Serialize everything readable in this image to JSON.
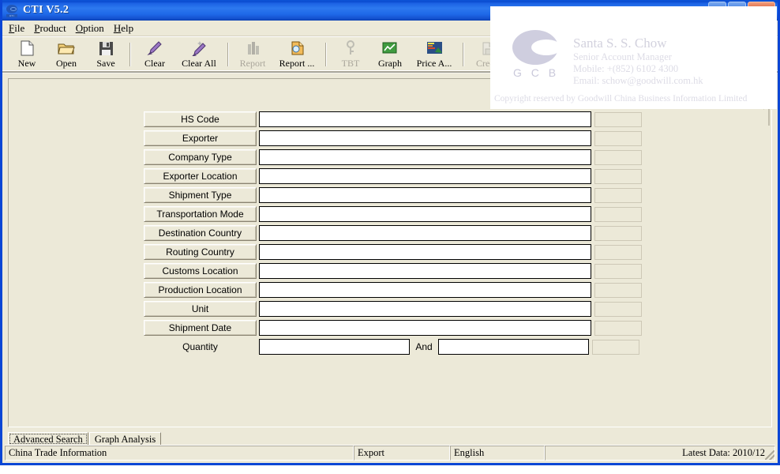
{
  "window": {
    "title": "CTI V5.2",
    "icon": "gcb-logo-icon",
    "buttons": {
      "minimize": "_",
      "maximize": "□",
      "close": "✕"
    }
  },
  "menu": [
    {
      "name": "file",
      "accel": "F",
      "rest": "ile"
    },
    {
      "name": "product",
      "accel": "P",
      "rest": "roduct"
    },
    {
      "name": "option",
      "accel": "O",
      "rest": "ption"
    },
    {
      "name": "help",
      "accel": "H",
      "rest": "elp"
    }
  ],
  "toolbar": [
    {
      "name": "new",
      "label": "New",
      "icon": "new-page-icon",
      "disabled": false
    },
    {
      "name": "open",
      "label": "Open",
      "icon": "open-folder-icon",
      "disabled": false
    },
    {
      "name": "save",
      "label": "Save",
      "icon": "floppy-disk-icon",
      "disabled": false
    },
    {
      "name": "clear",
      "label": "Clear",
      "icon": "pencil-icon",
      "disabled": false
    },
    {
      "name": "clear-all",
      "label": "Clear All",
      "icon": "pencil-sparkle-icon",
      "disabled": false
    },
    {
      "name": "report",
      "label": "Report",
      "icon": "report-icon",
      "disabled": true
    },
    {
      "name": "report-dots",
      "label": "Report ...",
      "icon": "report-page-icon",
      "disabled": false
    },
    {
      "name": "tbt",
      "label": "TBT",
      "icon": "key-icon",
      "disabled": true
    },
    {
      "name": "graph",
      "label": "Graph",
      "icon": "graph-icon",
      "disabled": false
    },
    {
      "name": "price-analysis",
      "label": "Price A...",
      "icon": "price-chart-icon",
      "disabled": false
    },
    {
      "name": "credit",
      "label": "Credit",
      "icon": "credit-icon",
      "disabled": true
    }
  ],
  "form": {
    "rows": [
      {
        "name": "hs-code",
        "label": "HS Code",
        "value": "",
        "button_label": true
      },
      {
        "name": "exporter",
        "label": "Exporter",
        "value": "",
        "button_label": true
      },
      {
        "name": "company-type",
        "label": "Company Type",
        "value": "",
        "button_label": true
      },
      {
        "name": "exporter-location",
        "label": "Exporter Location",
        "value": "",
        "button_label": true
      },
      {
        "name": "shipment-type",
        "label": "Shipment Type",
        "value": "",
        "button_label": true
      },
      {
        "name": "transportation-mode",
        "label": "Transportation Mode",
        "value": "",
        "button_label": true
      },
      {
        "name": "destination-country",
        "label": "Destination Country",
        "value": "",
        "button_label": true
      },
      {
        "name": "routing-country",
        "label": "Routing Country",
        "value": "",
        "button_label": true
      },
      {
        "name": "customs-location",
        "label": "Customs Location",
        "value": "",
        "button_label": true
      },
      {
        "name": "production-location",
        "label": "Production Location",
        "value": "",
        "button_label": true
      },
      {
        "name": "unit",
        "label": "Unit",
        "value": "",
        "button_label": true
      },
      {
        "name": "shipment-date",
        "label": "Shipment Date",
        "value": "",
        "button_label": true
      }
    ],
    "quantity": {
      "label": "Quantity",
      "from_value": "",
      "separator": "And",
      "to_value": ""
    }
  },
  "tabs": [
    {
      "name": "advanced-search",
      "label": "Advanced Search",
      "active": true
    },
    {
      "name": "graph-analysis",
      "label": "Graph  Analysis",
      "active": false
    }
  ],
  "status_bar": {
    "main": "China Trade Information",
    "trade": "Export",
    "language": "English",
    "latest_data": "Latest Data: 2010/12"
  },
  "overlay_card": {
    "logo_text": "G C B",
    "name": "Santa S. S. Chow",
    "title": "Senior Account Manager",
    "mobile": "Mobile: +(852) 6102 4300",
    "email": "Email: schow@goodwill.com.hk",
    "copyright": "Copyright reserved by Goodwill China Business Information Limited"
  },
  "colors": {
    "titlebar_blue": "#0b46d5",
    "window_face": "#ece9d8",
    "input_white": "#ffffff",
    "border_shadow": "#aca899"
  }
}
